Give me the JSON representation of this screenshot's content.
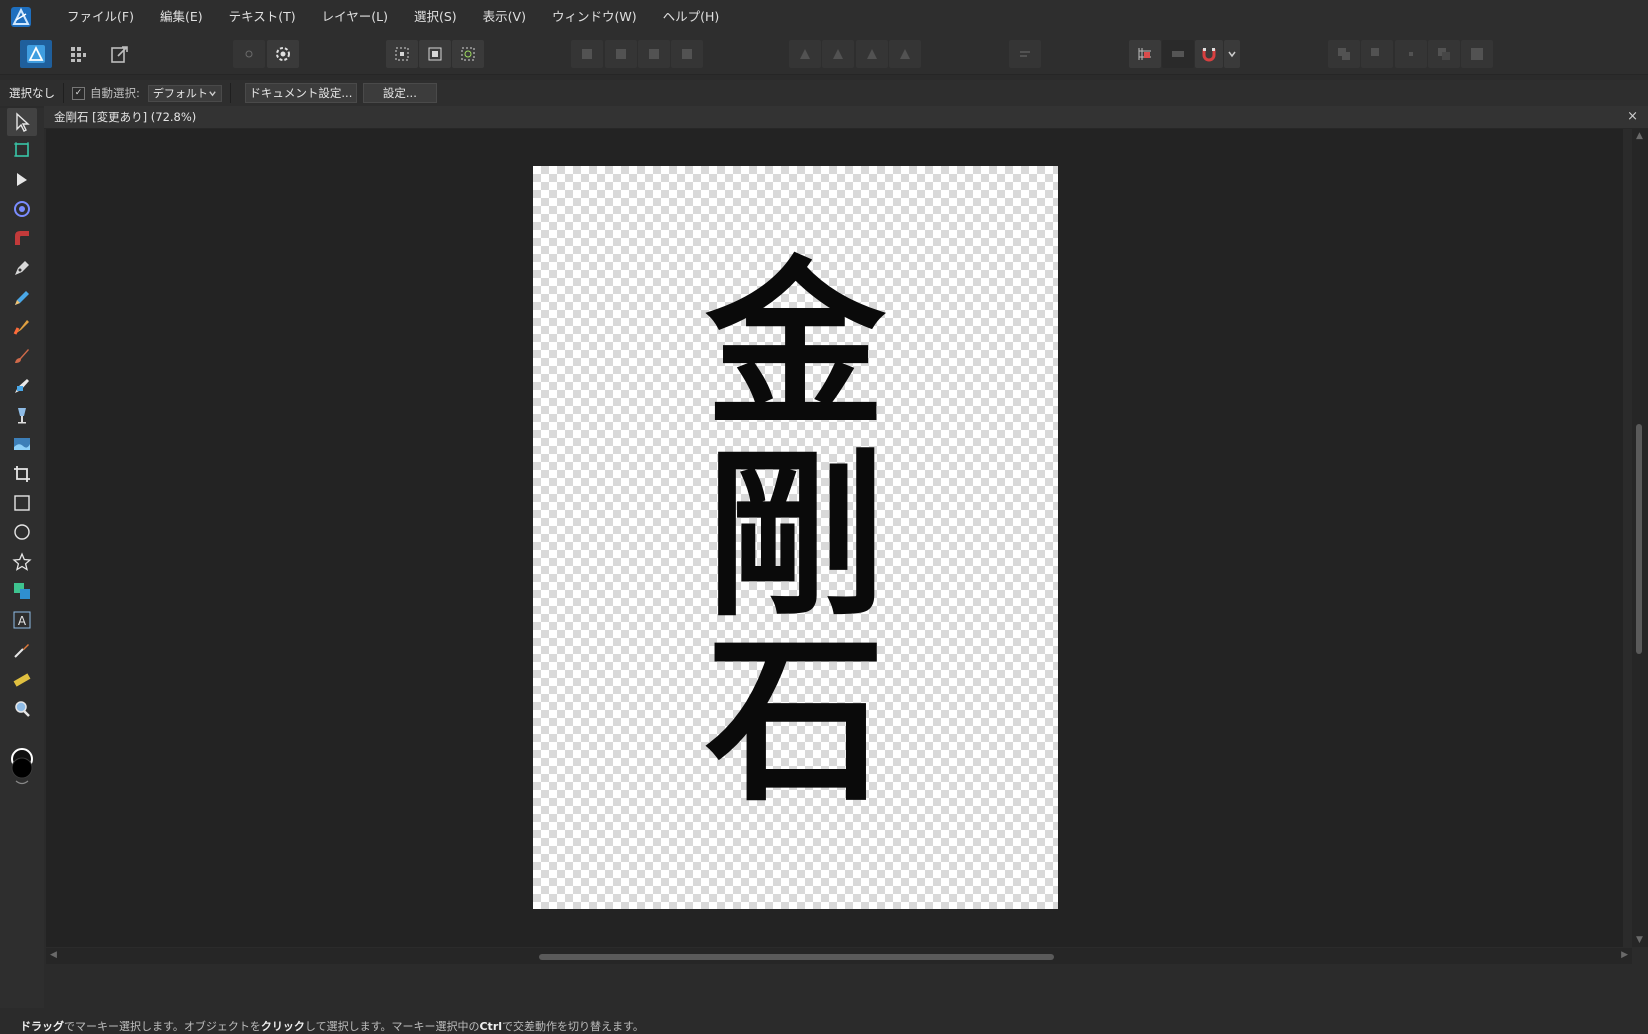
{
  "menu": [
    "ファイル(F)",
    "編集(E)",
    "テキスト(T)",
    "レイヤー(L)",
    "選択(S)",
    "表示(V)",
    "ウィンドウ(W)",
    "ヘルプ(H)"
  ],
  "context_toolbar": {
    "selection_status": "選択なし",
    "auto_select_label": "自動選択:",
    "auto_select_value": "デフォルト",
    "doc_setup_button": "ドキュメント設定...",
    "settings_button": "設定..."
  },
  "document": {
    "tab_title": "金剛石 [変更あり] (72.8%)",
    "close_glyph": "×",
    "artwork_characters": [
      "金",
      "剛",
      "石"
    ]
  },
  "statusbar": {
    "parts": [
      {
        "text": "ドラッグ",
        "bold": true
      },
      {
        "text": "でマーキー選択します。オブジェクトを",
        "bold": false
      },
      {
        "text": "クリック",
        "bold": true
      },
      {
        "text": "して選択します。マーキー選択中の",
        "bold": false
      },
      {
        "text": "Ctrl",
        "bold": true
      },
      {
        "text": "で交差動作を切り替えます。",
        "bold": false
      }
    ]
  },
  "colors": {
    "accent": "#3f9de0",
    "fill_color": "#000000",
    "stroke_color": "#ffffff"
  },
  "tools": [
    "move-tool-icon",
    "artboard-tool-icon",
    "node-tool-icon",
    "contour-tool-icon",
    "corner-tool-icon",
    "pen-tool-icon",
    "pencil-tool-icon",
    "vector-brush-tool-icon",
    "paint-brush-tool-icon",
    "pixel-brush-tool-icon",
    "fill-tool-icon",
    "transparency-tool-icon",
    "crop-tool-icon",
    "rectangle-tool-icon",
    "ellipse-tool-icon",
    "star-tool-icon",
    "shape-builder-tool-icon",
    "artistic-text-tool-icon",
    "color-picker-tool-icon",
    "measure-tool-icon",
    "zoom-tool-icon"
  ]
}
